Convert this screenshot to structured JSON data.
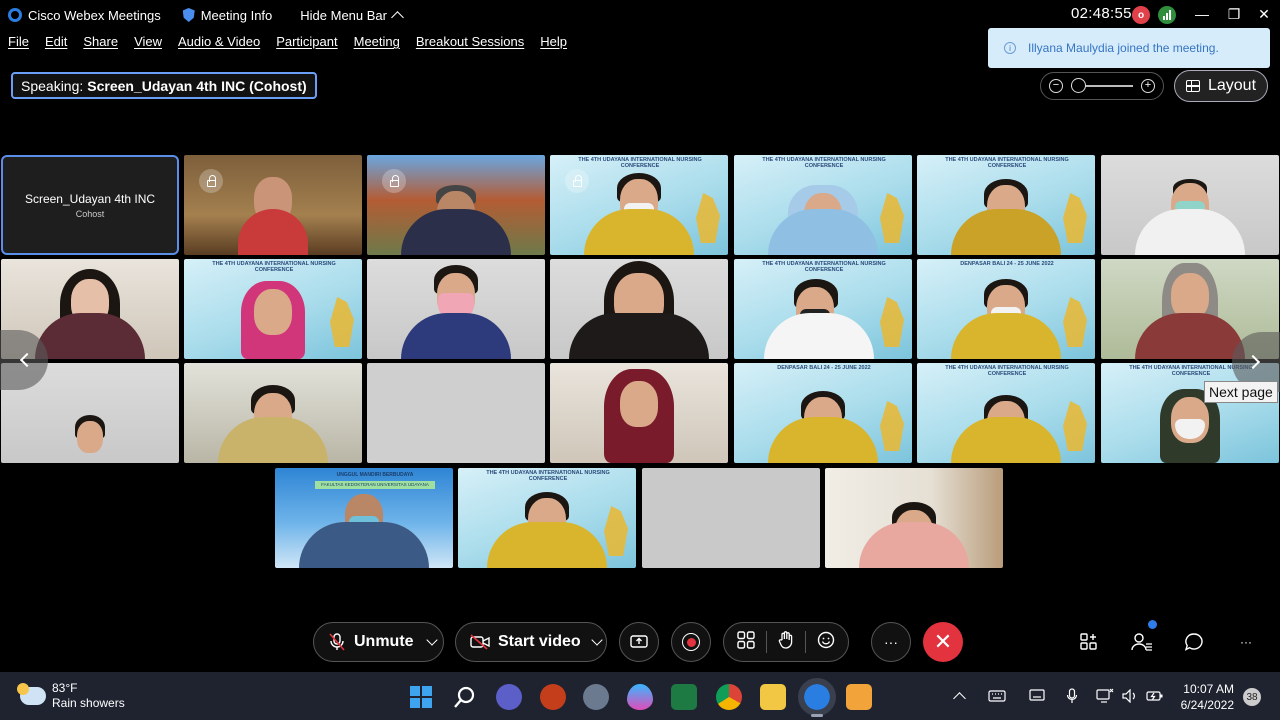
{
  "titlebar": {
    "app_name": "Cisco Webex Meetings",
    "meeting_info": "Meeting Info",
    "hide_menu": "Hide Menu Bar",
    "timer": "02:48:55",
    "recording_badge": "o",
    "minimize": "—",
    "restore": "❐",
    "close": "✕"
  },
  "menu": [
    "File",
    "Edit",
    "Share",
    "View",
    "Audio & Video",
    "Participant",
    "Meeting",
    "Breakout Sessions",
    "Help"
  ],
  "speaking": {
    "label": "Speaking:",
    "name": "Screen_Udayan 4th INC (Cohost)"
  },
  "toast": {
    "message": "Illyana Maulydia joined the meeting."
  },
  "zoom": {
    "level": 0.0
  },
  "layout_button": {
    "label": "Layout"
  },
  "grid": {
    "self_tile": {
      "name": "Screen_Udayan 4th INC",
      "role": "Cohost"
    },
    "conference_banner": "THE 4TH UDAYANA INTERNATIONAL NURSING CONFERENCE",
    "event_banner": "DENPASAR BALI 24 - 25 JUNE 2022",
    "webinar_banner_line1": "UNGGUL MANDIRI BERBUDAYA",
    "webinar_banner_line2": "FAKULTAS KEDOKTERAN UNIVERSITAS UDAYANA"
  },
  "next_page_tooltip": "Next page",
  "controls": {
    "unmute": "Unmute",
    "start_video": "Start video",
    "more": "···",
    "side_more": "···",
    "end": "✕"
  },
  "taskbar": {
    "temperature": "83°F",
    "weather": "Rain showers",
    "time": "10:07 AM",
    "date": "6/24/2022",
    "notifications": "38"
  },
  "colors": {
    "accent_blue": "#6b9ff7",
    "end_call_red": "#e2333f",
    "toast_bg": "#d7ecfb"
  }
}
